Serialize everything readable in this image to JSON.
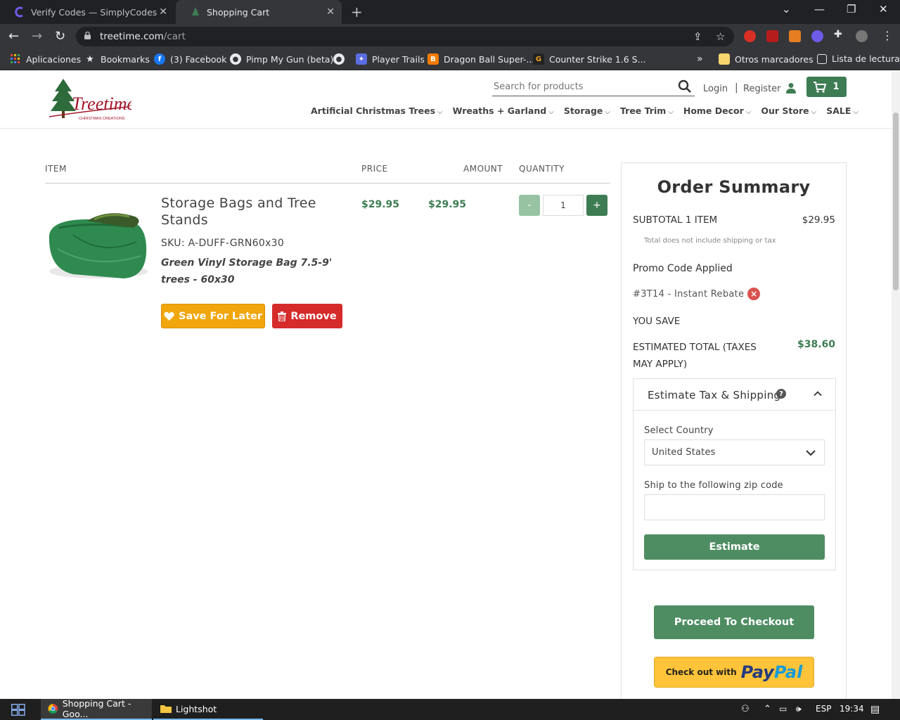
{
  "browser": {
    "tabs": [
      {
        "title": "Verify Codes — SimplyCodes",
        "active": false
      },
      {
        "title": "Shopping Cart",
        "active": true
      }
    ],
    "url": {
      "host": "treetime.com",
      "path": "/cart"
    },
    "bookmarks": [
      {
        "label": "Aplicaciones",
        "icon": "apps-grid-icon"
      },
      {
        "label": "Bookmarks",
        "icon": "star-icon"
      },
      {
        "label": "(3) Facebook",
        "icon": "facebook-icon"
      },
      {
        "label": "Pimp My Gun (beta)",
        "icon": "globe-icon"
      },
      {
        "label": "",
        "icon": "globe-icon"
      },
      {
        "label": "Player Trails",
        "icon": "player-trails-icon"
      },
      {
        "label": "Dragon Ball Super-...",
        "icon": "blogger-icon"
      },
      {
        "label": "Counter Strike 1.6 S...",
        "icon": "gamebanana-icon"
      }
    ],
    "other_bookmarks": "Otros marcadores",
    "reading_list": "Lista de lectura"
  },
  "site": {
    "logo_alt": "Treetime",
    "logo_sub": "CHRISTMAS CREATIONS",
    "search_placeholder": "Search for products",
    "login": "Login",
    "separator": "|",
    "register": "Register",
    "cart_count": "1",
    "nav": [
      "Artificial Christmas Trees",
      "Wreaths + Garland",
      "Storage",
      "Tree Trim",
      "Home Decor",
      "Our Store",
      "SALE"
    ]
  },
  "cart": {
    "headers": {
      "item": "ITEM",
      "price": "PRICE",
      "amount": "AMOUNT",
      "quantity": "QUANTITY"
    },
    "item": {
      "name": "Storage Bags and Tree Stands",
      "sku": "SKU: A-DUFF-GRN60x30",
      "description": "Green Vinyl Storage Bag 7.5-9' trees - 60x30",
      "price": "$29.95",
      "amount": "$29.95",
      "quantity": "1",
      "minus": "-",
      "plus": "+",
      "save_label": "Save For Later",
      "remove_label": "Remove"
    }
  },
  "summary": {
    "title": "Order Summary",
    "subtotal_label": "SUBTOTAL 1 ITEM",
    "subtotal_value": "$29.95",
    "note": "Total does not include shipping or tax",
    "promo_label": "Promo Code Applied",
    "promo_code": "#3T14 - Instant Rebate",
    "you_save": "YOU SAVE",
    "total_label": "ESTIMATED TOTAL (TAXES MAY APPLY)",
    "total_value": "$38.60",
    "estimate": {
      "title": "Estimate Tax & Shipping",
      "country_label": "Select Country",
      "country_value": "United States",
      "zip_label": "Ship to the following zip code",
      "zip_value": "",
      "button": "Estimate"
    },
    "checkout_button": "Proceed To Checkout",
    "paypal_prefix": "Check out with",
    "paypal_brand_1": "Pay",
    "paypal_brand_2": "Pal"
  },
  "taskbar": {
    "items": [
      {
        "label": "Shopping Cart - Goo...",
        "active": true
      },
      {
        "label": "Lightshot",
        "active": false
      }
    ],
    "language": "ESP",
    "time": "19:34"
  },
  "colors": {
    "brand_green": "#3e7d53",
    "button_green": "#4e8d62",
    "save_orange": "#f0a60c",
    "remove_red": "#d52b2b",
    "paypal_yellow": "#ffc439"
  }
}
